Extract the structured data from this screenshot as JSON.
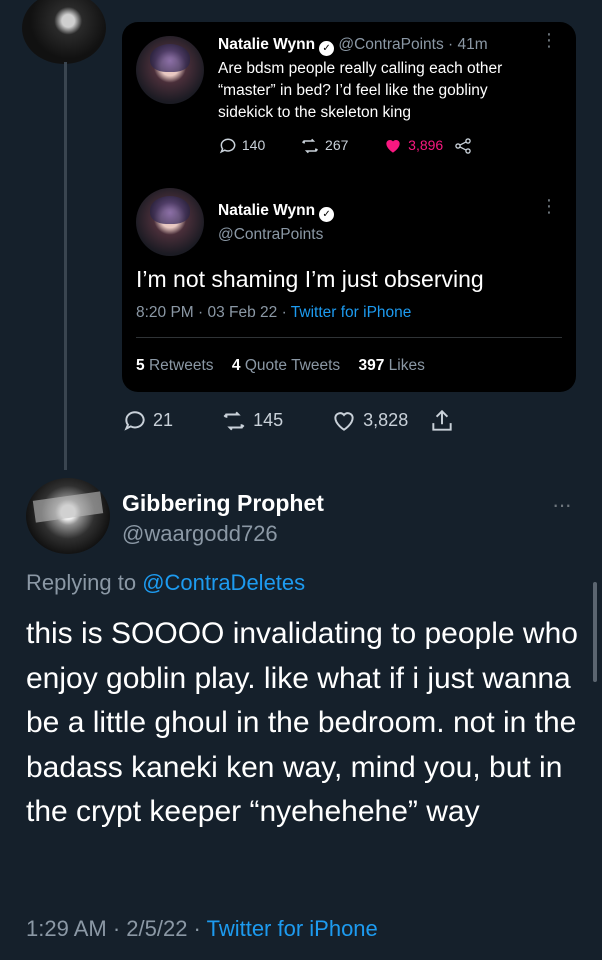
{
  "colors": {
    "background": "#15202b",
    "card": "#000000",
    "muted": "#8b98a5",
    "link": "#1d9bf0",
    "like": "#f91880"
  },
  "quoted": {
    "first_tweet": {
      "name": "Natalie Wynn",
      "handle": "@ContraPoints",
      "time": "· 41m",
      "text": "Are bdsm people really calling each other “master” in bed? I’d feel like the gobliny sidekick to the skeleton king",
      "replies": "140",
      "retweets": "267",
      "likes": "3,896"
    },
    "second_tweet": {
      "name": "Natalie Wynn",
      "handle": "@ContraPoints",
      "text": "I’m not shaming I’m just observing",
      "timestamp": "8:20 PM · 03 Feb 22 · ",
      "source": "Twitter for iPhone",
      "retweets_count": "5",
      "retweets_label": "Retweets",
      "quotes_count": "4",
      "quotes_label": "Quote Tweets",
      "likes_count": "397",
      "likes_label": "Likes"
    }
  },
  "outer_actions": {
    "replies": "21",
    "retweets": "145",
    "likes": "3,828"
  },
  "main_tweet": {
    "name": "Gibbering Prophet",
    "handle": "@waargodd726",
    "replying_prefix": "Replying to ",
    "replying_to": "@ContraDeletes",
    "text": "this is SOOOO invalidating to people who enjoy goblin play. like what if i just wanna be a little ghoul in the bedroom. not in the badass kaneki ken way, mind you, but in the crypt keeper “nyehehehe” way",
    "timestamp": "1:29 AM · 2/5/22 · ",
    "source": "Twitter for iPhone"
  },
  "icons": [
    "reply-icon",
    "retweet-icon",
    "heart-icon",
    "share-icon",
    "verified-icon",
    "more-icon"
  ]
}
